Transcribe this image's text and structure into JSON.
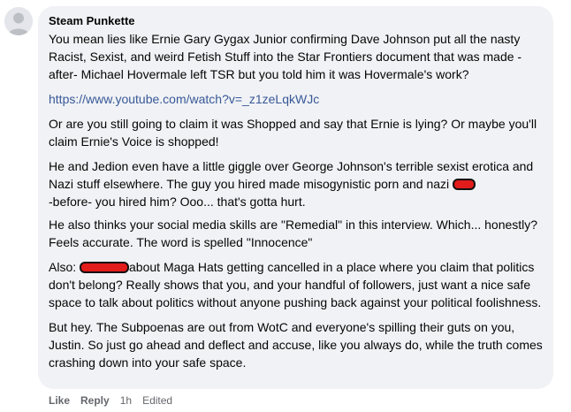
{
  "comment": {
    "author": "Steam Punkette",
    "paragraphs": {
      "p1": "You mean lies like Ernie Gary Gygax Junior confirming Dave Johnson put all the nasty Racist, Sexist, and weird Fetish Stuff into the Star Frontiers document that was made -after- Michael Hovermale left TSR but you told him it was Hovermale's work?",
      "link": "https://www.youtube.com/watch?v=_z1zeLqkWJc",
      "p2": "Or are you still going to claim it was Shopped and say that Ernie is lying? Or maybe you'll claim Ernie's Voice is shopped!",
      "p3a": "He and Jedion even have a little giggle over George Johnson's terrible sexist erotica and Nazi stuff elsewhere. The guy you hired made misogynistic porn and nazi ",
      "p3b": "-before- you hired him? Ooo... that's gotta hurt.",
      "p4": "He also thinks your social media skills are \"Remedial\" in this interview. Which... honestly? Feels accurate. The word is spelled \"Innocence\"",
      "p5a": "Also: ",
      "p5b": "about Maga Hats getting cancelled in a place where you claim that politics don't belong? Really shows that you, and your handful of followers, just want a nice safe space to talk about politics without anyone pushing back against your political foolishness.",
      "p6": "But hey. The Subpoenas are out from WotC and everyone's spilling their guts on you, Justin. So just go ahead and deflect and accuse, like you always do, while the truth comes crashing down into your safe space."
    }
  },
  "actions": {
    "like": "Like",
    "reply": "Reply",
    "time": "1h",
    "edited": "Edited"
  },
  "colors": {
    "bubble_bg": "#f0f2f5",
    "link": "#385898",
    "redaction": "#e21b1b",
    "muted_text": "#65676b"
  },
  "icons": {
    "avatar": "default-profile-avatar-icon"
  }
}
